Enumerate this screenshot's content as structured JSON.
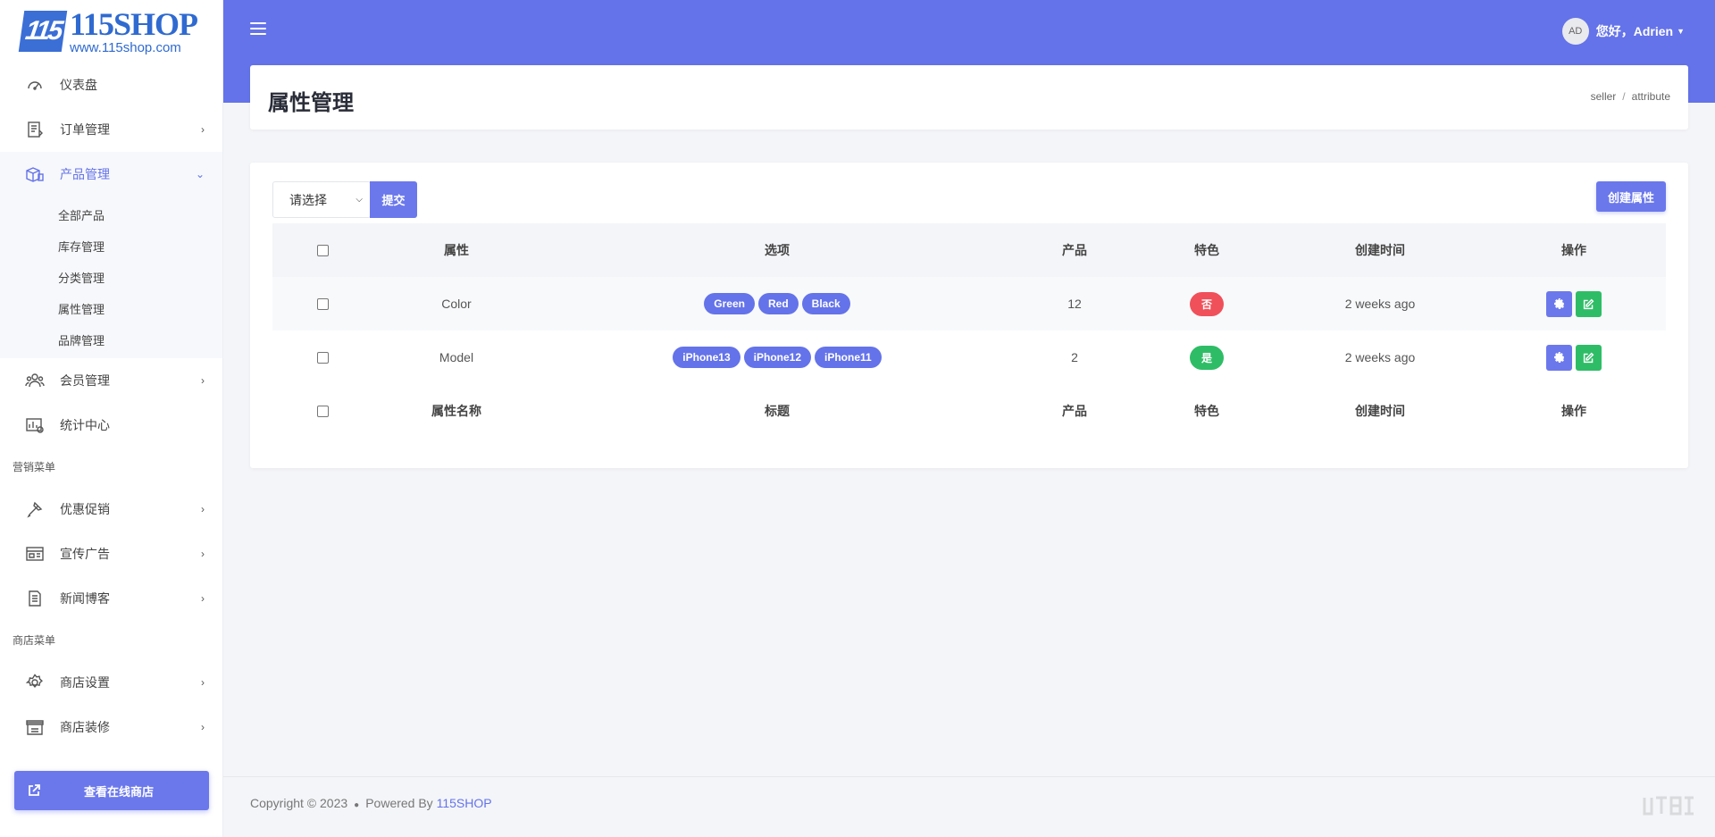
{
  "sidebar": {
    "logo": {
      "title": "115SHOP",
      "url": "www.115shop.com",
      "mark": "115"
    },
    "items_top": [
      {
        "label": "仪表盘",
        "icon": "dashboard-icon"
      },
      {
        "label": "订单管理",
        "icon": "orders-icon"
      },
      {
        "label": "产品管理",
        "icon": "products-icon",
        "active": true
      }
    ],
    "submenu": [
      "全部产品",
      "库存管理",
      "分类管理",
      "属性管理",
      "品牌管理"
    ],
    "items_mid": [
      {
        "label": "会员管理",
        "icon": "members-icon"
      },
      {
        "label": "统计中心",
        "icon": "statistics-icon"
      }
    ],
    "section_marketing": "营销菜单",
    "items_marketing": [
      {
        "label": "优惠促销",
        "icon": "promotion-icon"
      },
      {
        "label": "宣传广告",
        "icon": "ads-icon"
      },
      {
        "label": "新闻博客",
        "icon": "news-icon"
      }
    ],
    "section_store": "商店菜单",
    "items_store": [
      {
        "label": "商店设置",
        "icon": "settings-icon"
      },
      {
        "label": "商店装修",
        "icon": "store-decor-icon"
      }
    ],
    "store_button": "查看在线商店"
  },
  "header": {
    "greeting": "您好，",
    "username": "Adrien",
    "avatar_initials": "AD"
  },
  "page": {
    "title": "属性管理",
    "breadcrumb": [
      "seller",
      "attribute"
    ]
  },
  "toolbar": {
    "select_value": "请选择",
    "submit_label": "提交",
    "create_label": "创建属性"
  },
  "table": {
    "headers": [
      "属性",
      "选项",
      "产品",
      "特色",
      "创建时间",
      "操作"
    ],
    "footers": [
      "属性名称",
      "标题",
      "产品",
      "特色",
      "创建时间",
      "操作"
    ],
    "rows": [
      {
        "attribute": "Color",
        "options": [
          "Green",
          "Red",
          "Black"
        ],
        "products": "12",
        "featured": "否",
        "featured_state": "no",
        "created": "2 weeks ago"
      },
      {
        "attribute": "Model",
        "options": [
          "iPhone13",
          "iPhone12",
          "iPhone11"
        ],
        "products": "2",
        "featured": "是",
        "featured_state": "yes",
        "created": "2 weeks ago"
      }
    ]
  },
  "footer": {
    "copyright": "Copyright © 2023",
    "powered_by": "Powered By",
    "brand": "115SHOP"
  },
  "colors": {
    "accent": "#6473e9",
    "success": "#2ebd66",
    "danger": "#f0505a"
  }
}
